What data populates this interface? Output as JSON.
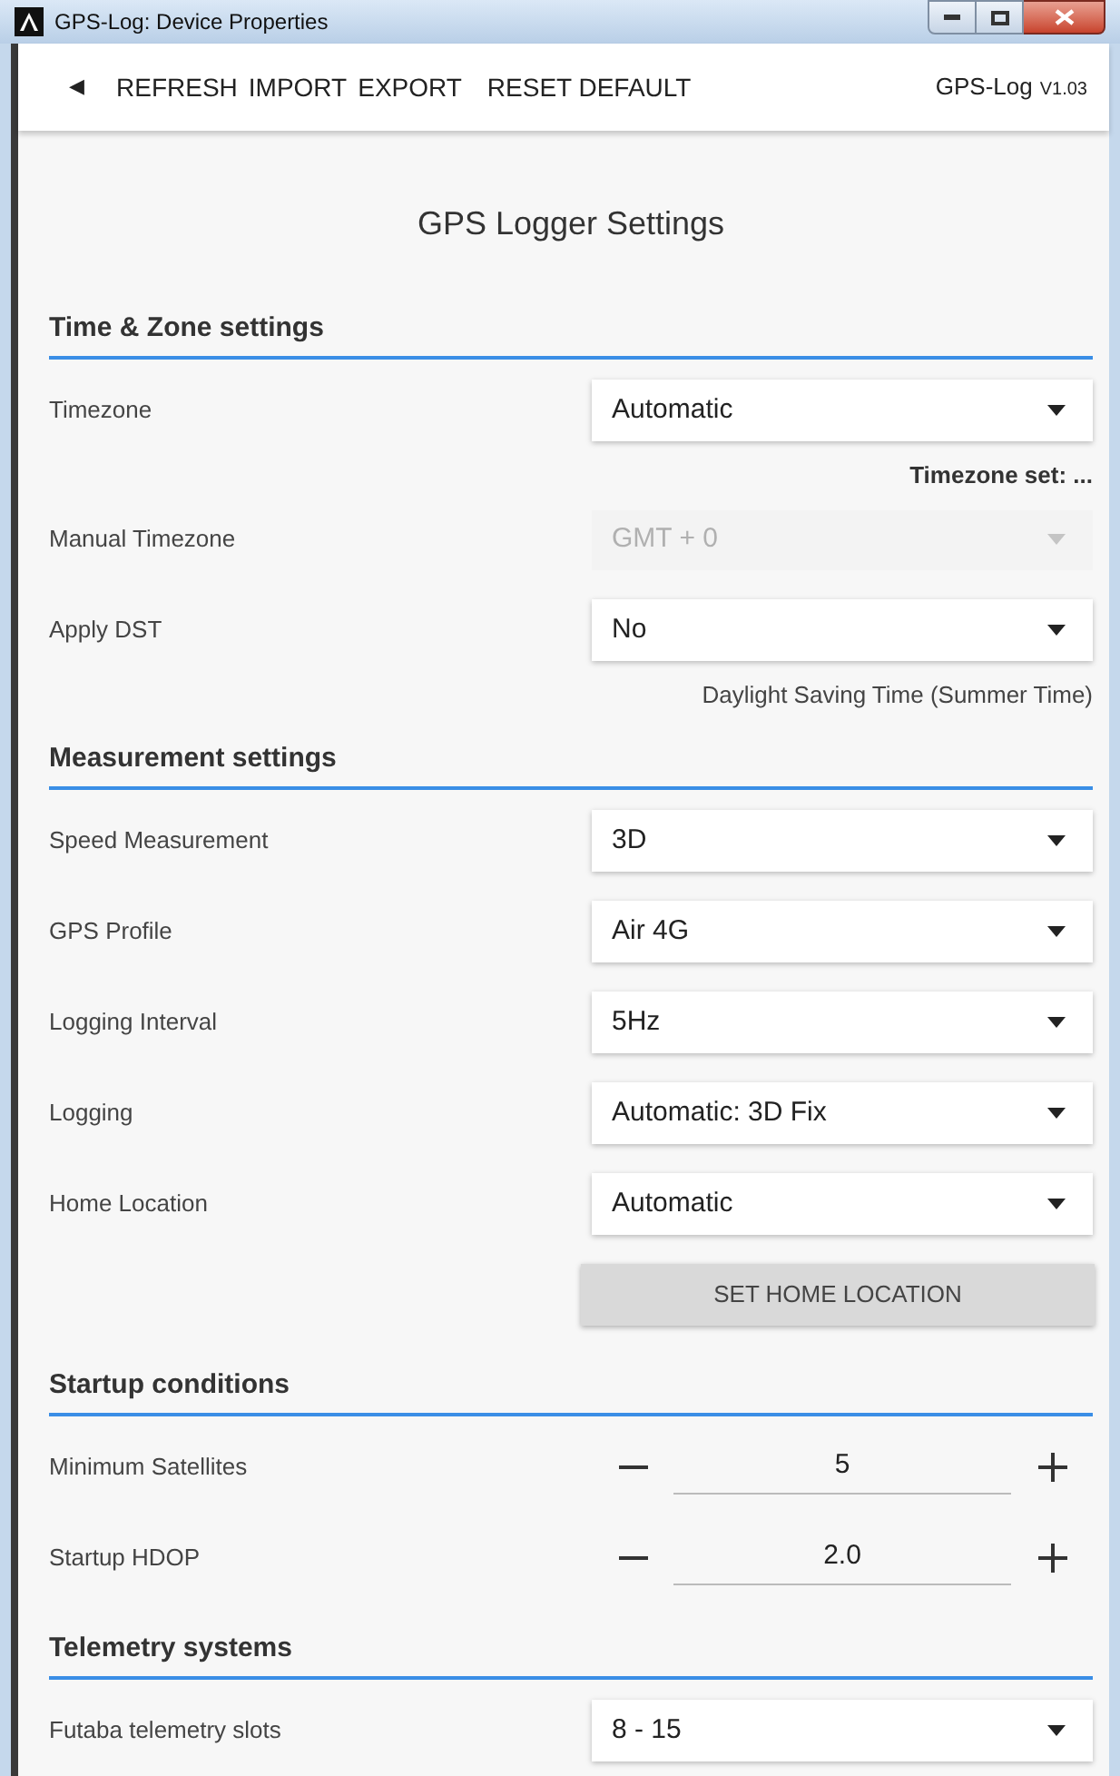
{
  "window": {
    "title": "GPS-Log: Device Properties"
  },
  "toolbar": {
    "back": "◀",
    "items": [
      "REFRESH",
      "IMPORT",
      "EXPORT",
      "RESET DEFAULT"
    ],
    "app_name": "GPS-Log",
    "version": "V1.03"
  },
  "page_title": "GPS Logger Settings",
  "sections": [
    {
      "title": "Time & Zone settings",
      "rows": [
        {
          "kind": "select",
          "label": "Timezone",
          "value": "Automatic",
          "disabled": false
        },
        {
          "kind": "note",
          "text": "Timezone set: ...",
          "bold": true
        },
        {
          "kind": "select",
          "label": "Manual Timezone",
          "value": "GMT + 0",
          "disabled": true
        },
        {
          "kind": "select",
          "label": "Apply DST",
          "value": "No",
          "disabled": false
        },
        {
          "kind": "note",
          "text": "Daylight Saving Time (Summer Time)",
          "bold": false
        }
      ]
    },
    {
      "title": "Measurement settings",
      "rows": [
        {
          "kind": "select",
          "label": "Speed Measurement",
          "value": "3D",
          "disabled": false
        },
        {
          "kind": "select",
          "label": "GPS Profile",
          "value": "Air 4G",
          "disabled": false
        },
        {
          "kind": "select",
          "label": "Logging Interval",
          "value": "5Hz",
          "disabled": false
        },
        {
          "kind": "select",
          "label": "Logging",
          "value": "Automatic: 3D Fix",
          "disabled": false
        },
        {
          "kind": "select",
          "label": "Home Location",
          "value": "Automatic",
          "disabled": false
        },
        {
          "kind": "button",
          "label": "SET HOME LOCATION"
        }
      ]
    },
    {
      "title": "Startup conditions",
      "rows": [
        {
          "kind": "stepper",
          "label": "Minimum Satellites",
          "value": "5"
        },
        {
          "kind": "stepper",
          "label": "Startup HDOP",
          "value": "2.0"
        }
      ]
    },
    {
      "title": "Telemetry systems",
      "rows": [
        {
          "kind": "select",
          "label": "Futaba telemetry slots",
          "value": "8 - 15",
          "disabled": false
        }
      ]
    }
  ]
}
